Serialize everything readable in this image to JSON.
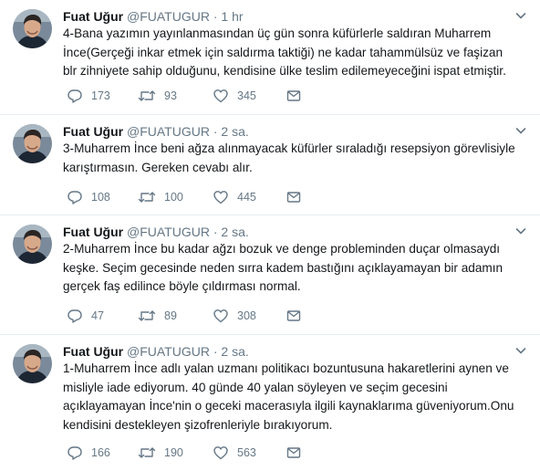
{
  "colors": {
    "text": "#14171a",
    "secondary": "#657786",
    "divider": "#e6ecf0"
  },
  "icons": {
    "reply": "reply-icon",
    "retweet": "retweet-icon",
    "like": "heart-icon",
    "dm": "envelope-icon",
    "more": "chevron-down-icon"
  },
  "tweets": [
    {
      "name": "Fuat Uğur",
      "handle": "@FUATUGUR",
      "dot": "·",
      "time": "1 hr",
      "lines": [
        "4-Bana yazımın yayınlanmasından üç gün sonra küfürlerle saldıran Muharrem",
        "İnce(Gerçeği inkar etmek için saldırma taktiği) ne kadar tahammülsüz ve faşizan",
        "blr zihniyete sahip olduğunu, kendisine ülke teslim edilemeyeceğini ispat etmiştir."
      ],
      "replies": "173",
      "retweets": "93",
      "likes": "345"
    },
    {
      "name": "Fuat Uğur",
      "handle": "@FUATUGUR",
      "dot": "·",
      "time": "2 sa.",
      "lines": [
        "3-Muharrem İnce beni ağza alınmayacak küfürler sıraladığı resepsiyon görevlisiyle",
        "karıştırmasın. Gereken cevabı alır."
      ],
      "replies": "108",
      "retweets": "100",
      "likes": "445"
    },
    {
      "name": "Fuat Uğur",
      "handle": "@FUATUGUR",
      "dot": "·",
      "time": "2 sa.",
      "lines": [
        "2-Muharrem İnce bu kadar ağzı bozuk ve denge probleminden duçar olmasaydı",
        "keşke. Seçim gecesinde neden sırra kadem bastığını açıklayamayan bir adamın",
        "gerçek faş edilince böyle çıldırması normal."
      ],
      "replies": "47",
      "retweets": "89",
      "likes": "308"
    },
    {
      "name": "Fuat Uğur",
      "handle": "@FUATUGUR",
      "dot": "·",
      "time": "2 sa.",
      "lines": [
        "1-Muharrem İnce adlı yalan uzmanı politikacı bozuntusuna hakaretlerini aynen ve",
        "misliyle iade ediyorum. 40 günde 40 yalan söyleyen ve seçim gecesini",
        "açıklayamayan İnce'nin o geceki macerasıyla ilgili kaynaklarıma güveniyorum.Onu",
        "kendisini destekleyen şizofrenleriyle bırakıyorum."
      ],
      "replies": "166",
      "retweets": "190",
      "likes": "563"
    }
  ]
}
